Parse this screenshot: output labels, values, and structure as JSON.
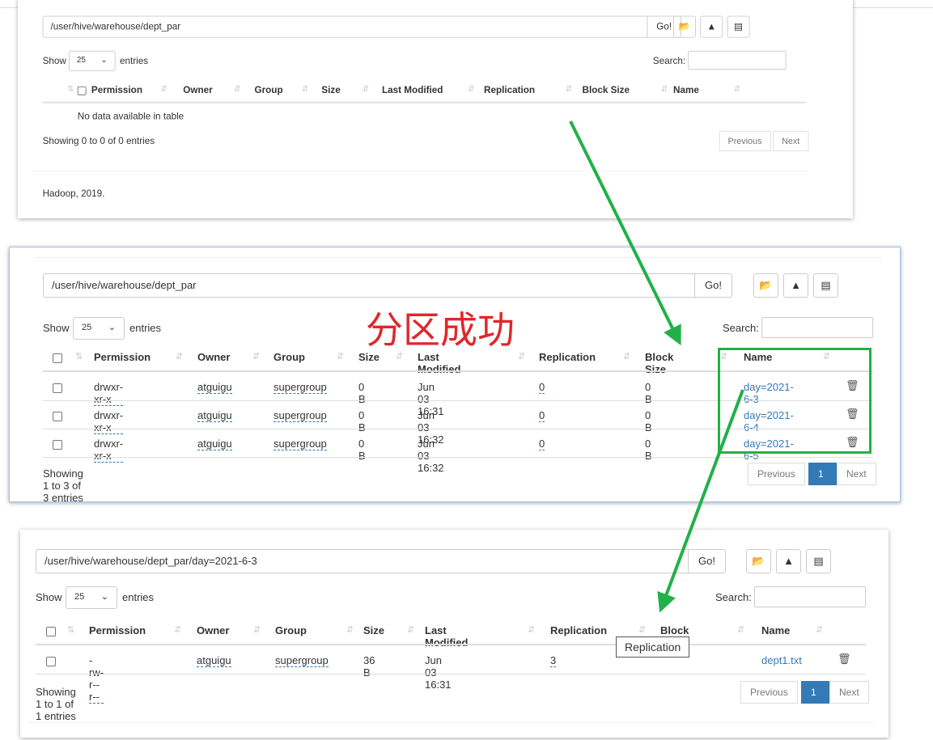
{
  "columns": [
    "Permission",
    "Owner",
    "Group",
    "Size",
    "Last Modified",
    "Replication",
    "Block Size",
    "Name"
  ],
  "common": {
    "go": "Go!",
    "show": "Show",
    "entries": "entries",
    "page_size": "25",
    "search_label": "Search:",
    "previous": "Previous",
    "next": "Next",
    "page": "1"
  },
  "panels": [
    {
      "path": "/user/hive/warehouse/dept_par",
      "empty": "No data available in table",
      "rows": [],
      "info": "Showing 0 to 0 of 0 entries",
      "footer": "Hadoop, 2019."
    },
    {
      "path": "/user/hive/warehouse/dept_par",
      "rows": [
        {
          "permission": "drwxr-xr-x",
          "owner": "atguigu",
          "group": "supergroup",
          "size": "0 B",
          "modified": "Jun 03 16:31",
          "replication": "0",
          "block_size": "0 B",
          "name": "day=2021-6-3"
        },
        {
          "permission": "drwxr-xr-x",
          "owner": "atguigu",
          "group": "supergroup",
          "size": "0 B",
          "modified": "Jun 03 16:32",
          "replication": "0",
          "block_size": "0 B",
          "name": "day=2021-6-4"
        },
        {
          "permission": "drwxr-xr-x",
          "owner": "atguigu",
          "group": "supergroup",
          "size": "0 B",
          "modified": "Jun 03 16:32",
          "replication": "0",
          "block_size": "0 B",
          "name": "day=2021-6-5"
        }
      ],
      "info": "Showing 1 to 3 of 3 entries"
    },
    {
      "path": "/user/hive/warehouse/dept_par/day=2021-6-3",
      "rows": [
        {
          "permission": "-rw-r--r--",
          "owner": "atguigu",
          "group": "supergroup",
          "size": "36 B",
          "modified": "Jun 03 16:31",
          "replication": "3",
          "block_size": "",
          "name": "dept1.txt"
        }
      ],
      "info": "Showing 1 to 1 of 1 entries",
      "tooltip": "Replication"
    }
  ],
  "annotation": {
    "text": "分区成功",
    "color": "#e0262a",
    "highlight_color": "#22b04a"
  },
  "icons": [
    "folder-open-icon",
    "upload-icon",
    "list-icon",
    "trash-icon",
    "sort-icon"
  ]
}
